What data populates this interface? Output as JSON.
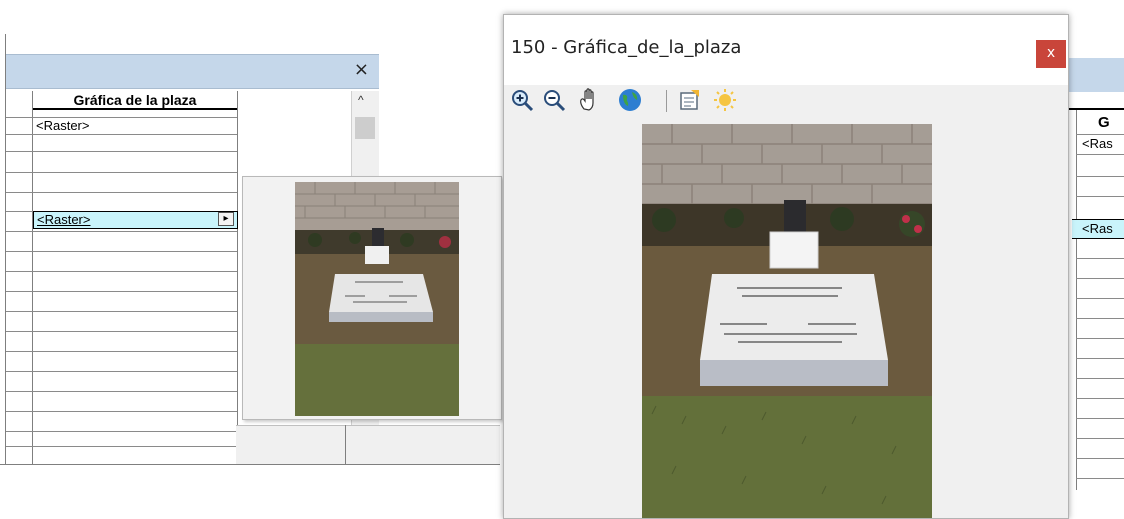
{
  "left_window": {
    "close_label": "×",
    "column_header": "Gráfica de la plaza",
    "rows": [
      "<Raster>",
      "<Raster>"
    ],
    "scroll_up_glyph": "^",
    "dropdown_glyph": "▸"
  },
  "viewer": {
    "title": "150 - Gráfica_de_la_plaza",
    "close_label": "x",
    "toolbar": {
      "zoom_in": "zoom-in-icon",
      "zoom_out": "zoom-out-icon",
      "pan": "pan-hand-icon",
      "full_extent": "globe-icon",
      "properties": "properties-icon",
      "brightness": "sun-icon"
    }
  },
  "right_table": {
    "column_header_partial": "G",
    "rows_partial": [
      "<Ras",
      "<Ras"
    ]
  },
  "colors": {
    "titlebar": "#c5d7ea",
    "selected_row": "#c9f4fb",
    "close_red": "#c9453a"
  }
}
